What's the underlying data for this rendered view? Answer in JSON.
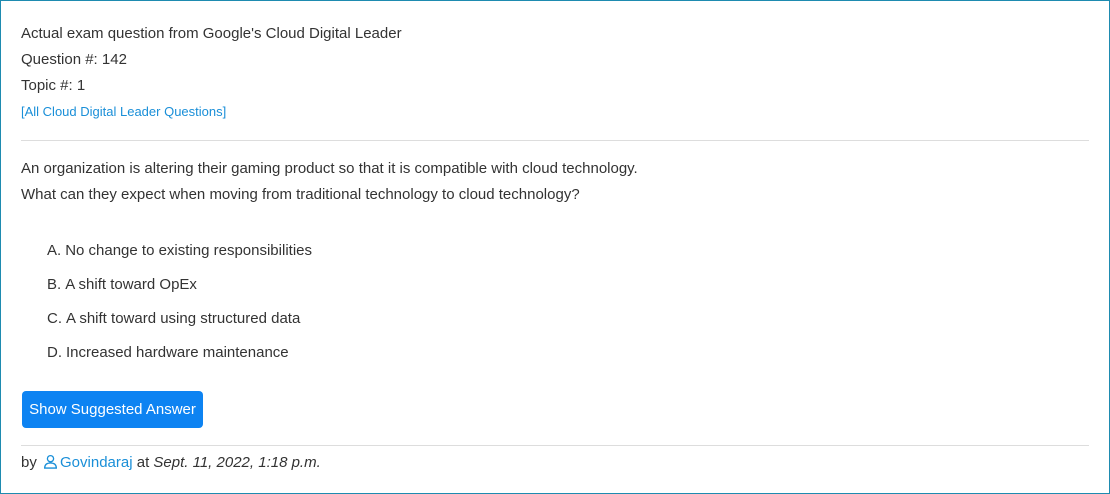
{
  "header": {
    "exam_line": "Actual exam question from Google's Cloud Digital Leader",
    "question_number": "Question #: 142",
    "topic_number": "Topic #: 1",
    "all_questions_link": "[All Cloud Digital Leader Questions]"
  },
  "question": {
    "line1": "An organization is altering their gaming product so that it is compatible with cloud technology.",
    "line2": "What can they expect when moving from traditional technology to cloud technology?"
  },
  "choices": [
    {
      "letter": "A.",
      "text": "No change to existing responsibilities"
    },
    {
      "letter": "B.",
      "text": "A shift toward OpEx"
    },
    {
      "letter": "C.",
      "text": "A shift toward using structured data"
    },
    {
      "letter": "D.",
      "text": "Increased hardware maintenance"
    }
  ],
  "show_answer_button": "Show Suggested Answer",
  "footer": {
    "by": "by",
    "author": "Govindaraj",
    "at": "at",
    "date": "Sept. 11, 2022, 1:18 p.m.",
    "user_icon": "user-outline-icon"
  },
  "colors": {
    "link": "#1a8fd8",
    "button": "#0d83f2",
    "border": "#1e8bb0"
  }
}
